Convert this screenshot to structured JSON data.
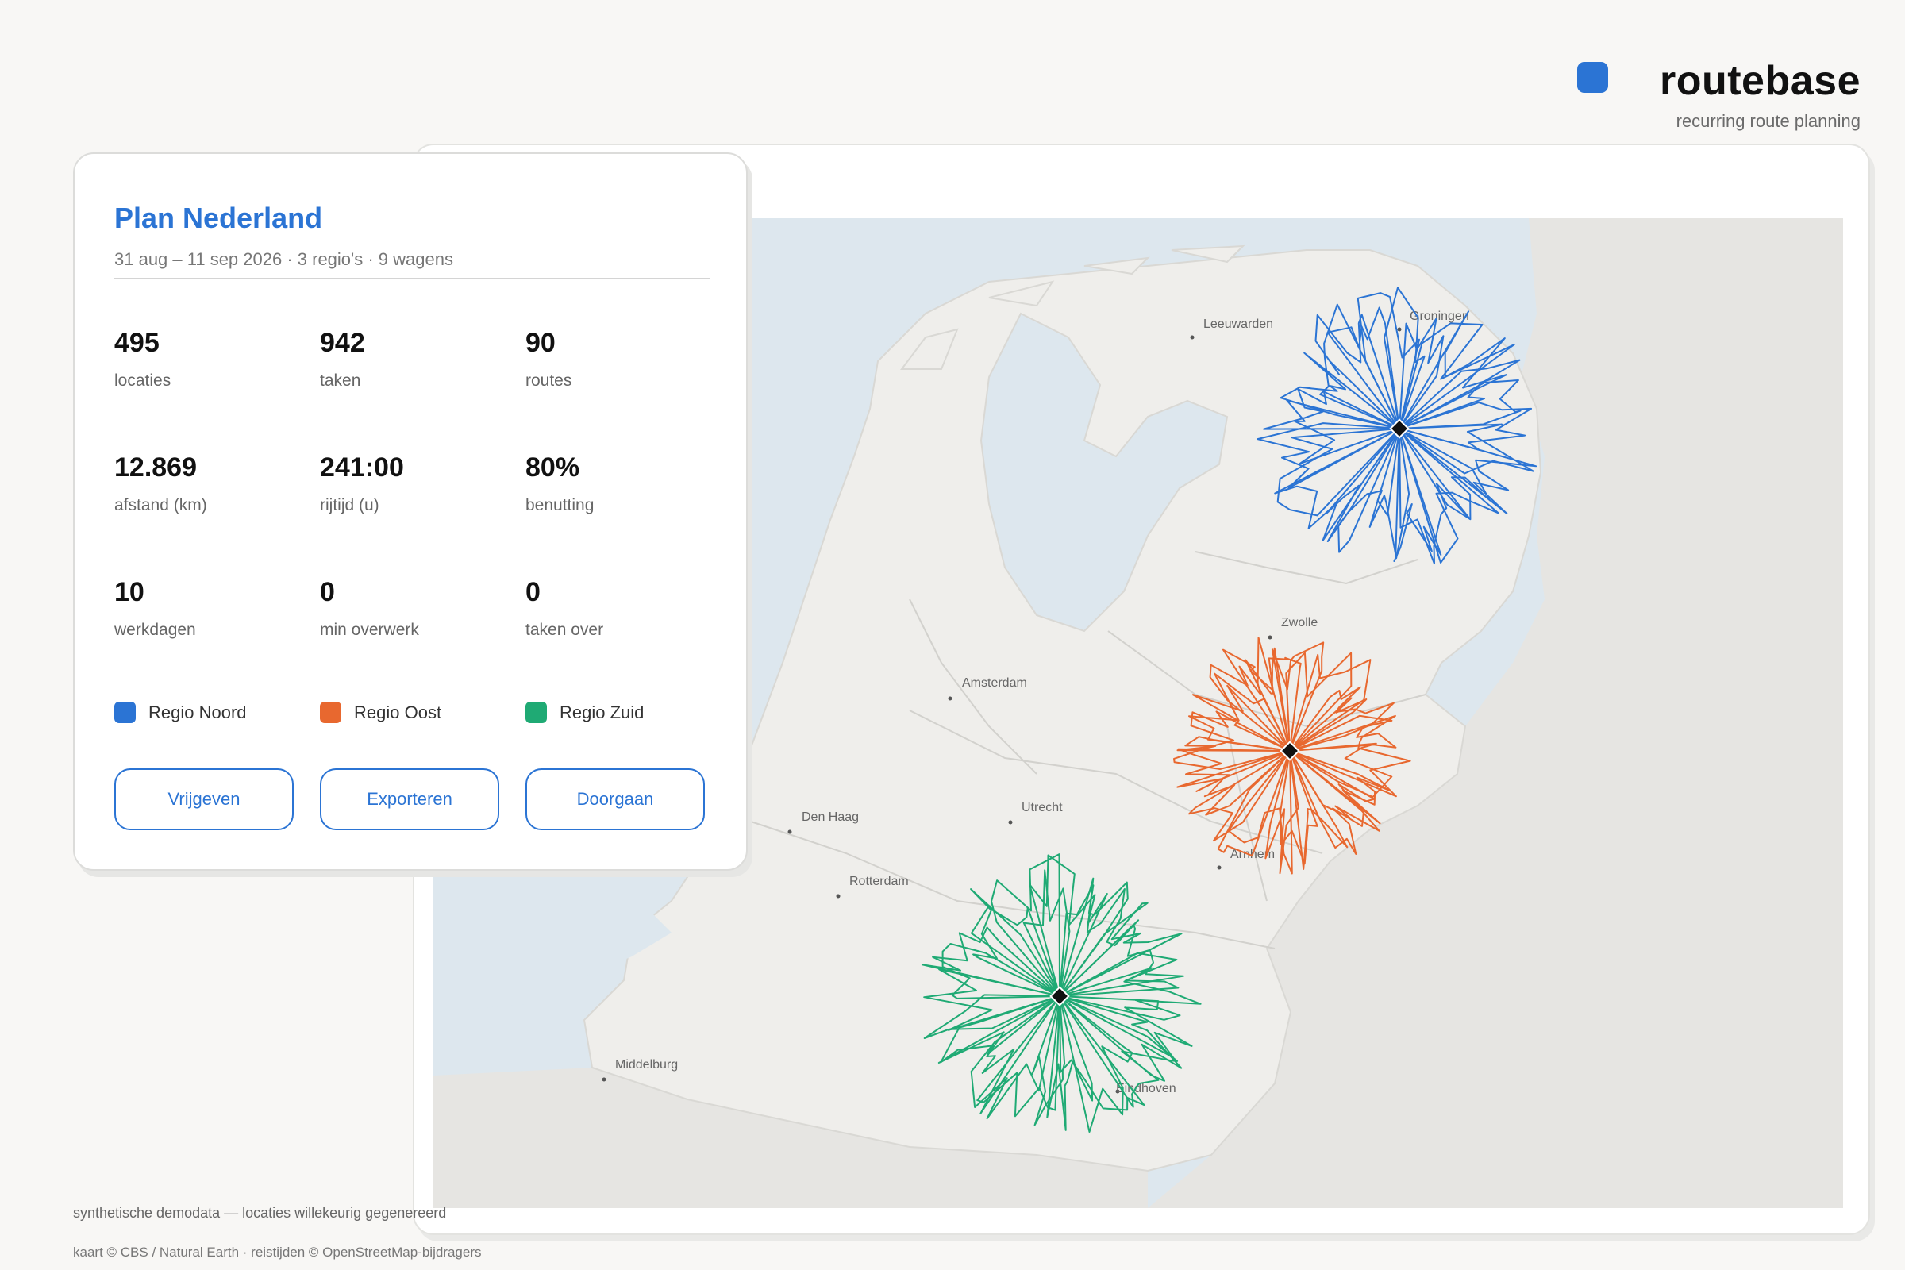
{
  "brand": {
    "name": "routebase",
    "tagline": "recurring route planning",
    "accent": "#2b74d4"
  },
  "plan": {
    "title": "Plan Nederland",
    "subtitle": "31 aug – 11 sep 2026 · 3 regio's · 9 wagens",
    "stats": [
      {
        "value": "495",
        "label": "locaties"
      },
      {
        "value": "942",
        "label": "taken"
      },
      {
        "value": "90",
        "label": "routes"
      },
      {
        "value": "12.869",
        "label": "afstand (km)"
      },
      {
        "value": "241:00",
        "label": "rijtijd (u)"
      },
      {
        "value": "80%",
        "label": "benutting"
      },
      {
        "value": "10",
        "label": "werkdagen"
      },
      {
        "value": "0",
        "label": "min overwerk"
      },
      {
        "value": "0",
        "label": "taken over"
      }
    ],
    "regions": [
      {
        "label": "Regio Noord",
        "color": "#2b74d4"
      },
      {
        "label": "Regio Oost",
        "color": "#e8682f"
      },
      {
        "label": "Regio Zuid",
        "color": "#1faa74"
      }
    ],
    "buttons": {
      "release": "Vrijgeven",
      "export": "Exporteren",
      "continue": "Doorgaan"
    }
  },
  "map": {
    "cities": [
      {
        "name": "Leeuwarden"
      },
      {
        "name": "Groningen"
      },
      {
        "name": "Zwolle"
      },
      {
        "name": "Amsterdam"
      },
      {
        "name": "Den Haag"
      },
      {
        "name": "Utrecht"
      },
      {
        "name": "Rotterdam"
      },
      {
        "name": "Arnhem"
      },
      {
        "name": "Middelburg"
      },
      {
        "name": "Eindhoven"
      }
    ],
    "water_color": "#dde7ee",
    "land_color": "#efeeeb",
    "outside_color": "#e6e5e2"
  },
  "footer": {
    "note": "synthetische demodata — locaties willekeurig gegenereerd",
    "credits": "kaart © CBS / Natural Earth · reistijden © OpenStreetMap-bijdragers"
  }
}
